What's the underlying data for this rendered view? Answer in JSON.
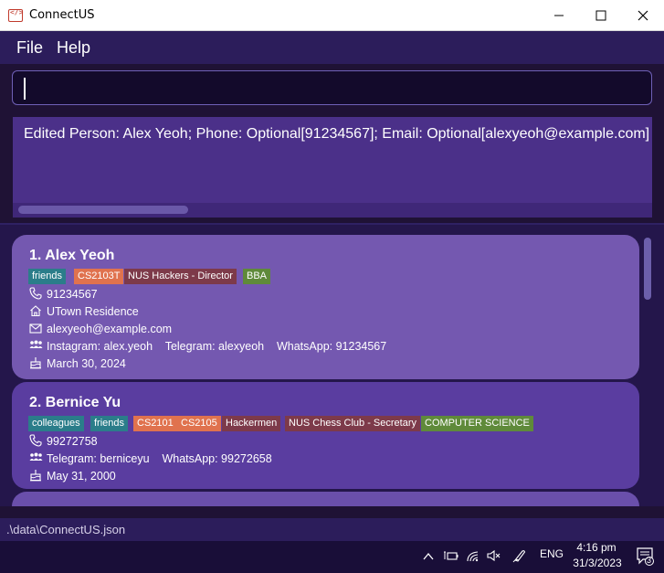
{
  "window": {
    "title": "ConnectUS"
  },
  "menu": {
    "file": "File",
    "help": "Help"
  },
  "command": {
    "value": ""
  },
  "result": {
    "text": "Edited Person: Alex Yeoh; Phone: Optional[91234567]; Email: Optional[alexyeoh@example.com]"
  },
  "persons": [
    {
      "title": "1.  Alex Yeoh",
      "tags": [
        {
          "label": "friends",
          "color": "#2b7d8a"
        },
        {
          "label": "CS2103T",
          "color": "#e0724e"
        },
        {
          "label": "NUS Hackers - Director",
          "color": "#7d3a4a"
        },
        {
          "label": "BBA",
          "color": "#5f8a3a"
        }
      ],
      "phone": "91234567",
      "address": "UTown Residence",
      "email": "alexyeoh@example.com",
      "socials": "Instagram: alex.yeoh    Telegram: alexyeoh    WhatsApp: 91234567",
      "birthday": "March 30, 2024"
    },
    {
      "title": "2.  Bernice Yu",
      "tags": [
        {
          "label": "colleagues",
          "color": "#2b7d8a"
        },
        {
          "label": "friends",
          "color": "#2b7d8a"
        },
        {
          "label": "CS2101",
          "color": "#e0724e"
        },
        {
          "label": "CS2105",
          "color": "#e0724e"
        },
        {
          "label": "Hackermen",
          "color": "#7d3a4a"
        },
        {
          "label": "NUS Chess Club - Secretary",
          "color": "#7d3a4a"
        },
        {
          "label": "COMPUTER SCIENCE",
          "color": "#5f8a3a"
        }
      ],
      "phone": "99272758",
      "socials": "Telegram: berniceyu    WhatsApp: 99272658",
      "birthday": "May 31, 2000"
    }
  ],
  "status": {
    "path": ".\\data\\ConnectUS.json"
  },
  "taskbar": {
    "language": "ENG",
    "time": "4:16 pm",
    "date": "31/3/2023",
    "notification_count": "3"
  },
  "colors": {
    "card1": "#7458b0",
    "card2": "#5a3da0",
    "background": "#24164b"
  }
}
